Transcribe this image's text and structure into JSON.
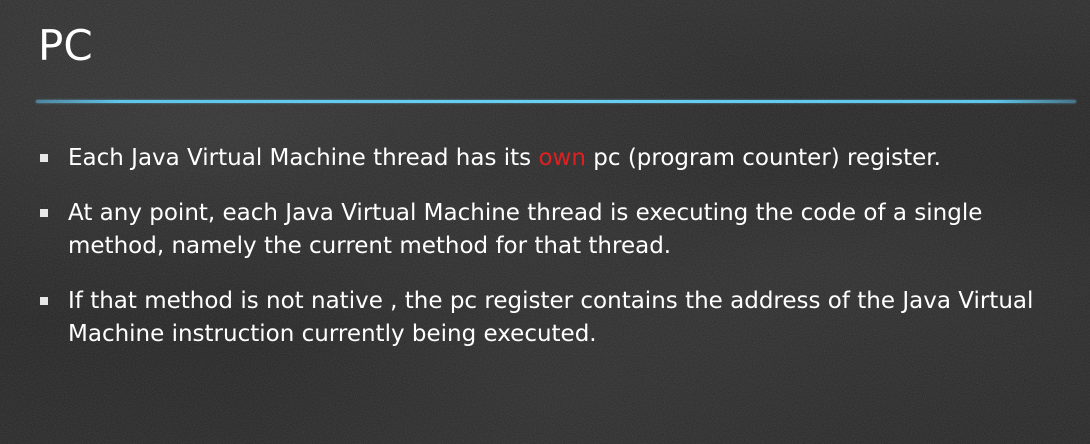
{
  "slide": {
    "title": "PC",
    "bullets": [
      {
        "before": "Each Java Virtual Machine thread has its ",
        "highlight": "own",
        "after": "  pc (program counter) register."
      },
      {
        "before": "At any point, each Java Virtual Machine thread is executing the code of a single method, namely the current method  for that thread.",
        "highlight": "",
        "after": ""
      },
      {
        "before": "If that method is not native , the  pc register contains the address of the Java Virtual Machine instruction currently being executed.",
        "highlight": "",
        "after": ""
      }
    ]
  },
  "colors": {
    "background": "#1e1e1e",
    "text": "#ffffff",
    "highlight": "#e02020",
    "divider": "#5fc6ea"
  }
}
